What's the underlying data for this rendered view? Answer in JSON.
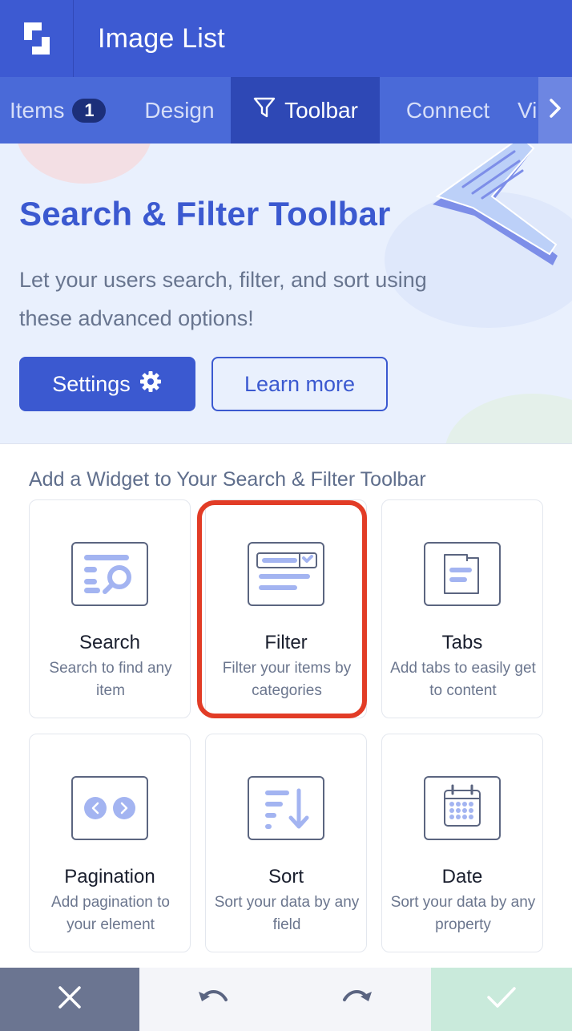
{
  "header": {
    "title": "Image List",
    "logo_icon": "logo-icon"
  },
  "tabs": {
    "items": [
      {
        "label": "Items",
        "badge": "1"
      },
      {
        "label": "Design"
      },
      {
        "label": "Toolbar",
        "icon": "funnel-icon",
        "active": true
      },
      {
        "label": "Connect"
      },
      {
        "label": "Vi"
      }
    ],
    "next_icon": "chevron-right-icon"
  },
  "hero": {
    "title": "Search & Filter Toolbar",
    "description": "Let your users search, filter, and sort using these advanced options!",
    "settings_label": "Settings",
    "settings_icon": "gear-icon",
    "learn_more_label": "Learn more"
  },
  "widgets": {
    "section_title": "Add a Widget to Your Search & Filter Toolbar",
    "items": [
      {
        "name": "Search",
        "desc": "Search to find any item",
        "icon": "search-widget-icon"
      },
      {
        "name": "Filter",
        "desc": "Filter your items by categories",
        "icon": "filter-widget-icon",
        "highlighted": true
      },
      {
        "name": "Tabs",
        "desc": "Add tabs to easily get to content",
        "icon": "tabs-widget-icon"
      },
      {
        "name": "Pagination",
        "desc": "Add pagination to your element",
        "icon": "pagination-widget-icon"
      },
      {
        "name": "Sort",
        "desc": "Sort your data by any field",
        "icon": "sort-widget-icon"
      },
      {
        "name": "Date",
        "desc": "Sort your data by any property",
        "icon": "calendar-widget-icon"
      }
    ]
  },
  "bottom_bar": {
    "close_icon": "close-icon",
    "undo_icon": "undo-icon",
    "redo_icon": "redo-icon",
    "confirm_icon": "check-icon"
  },
  "colors": {
    "primary": "#3d5ad2",
    "tab_active": "#2e48b5",
    "highlight": "#e23c26",
    "confirm_bg": "#c9eadb"
  }
}
